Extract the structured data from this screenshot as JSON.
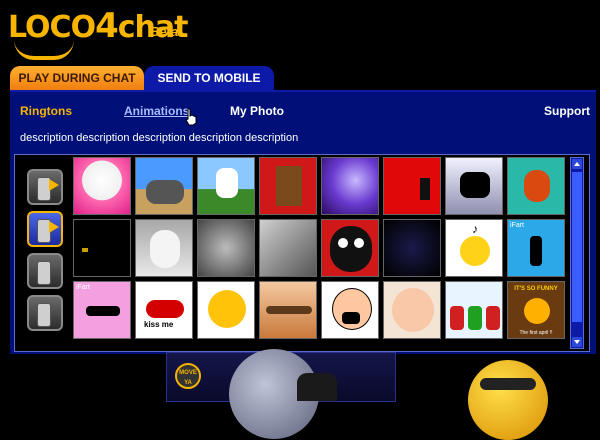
{
  "logo": {
    "text_a": "LOCO",
    "text_b": "4",
    "text_c": "chat",
    "beta": "Beta"
  },
  "tabs": [
    {
      "label": "PLAY DURING CHAT",
      "active": false
    },
    {
      "label": "SEND TO MOBILE",
      "active": true
    }
  ],
  "nav": {
    "ringtons": "Ringtons",
    "animations": "Animations",
    "my_photo": "My Photo",
    "support": "Support"
  },
  "description": "description description description description description",
  "colors": {
    "accent": "#f7b500",
    "panel": "#001078",
    "tab_active": "#0d1aa8"
  },
  "side_icons": [
    {
      "name": "ringtone-to-phone-icon",
      "active": false
    },
    {
      "name": "animation-to-phone-icon",
      "active": true
    },
    {
      "name": "phone-icon",
      "active": false
    },
    {
      "name": "phone-icon",
      "active": false
    }
  ],
  "thumbnails": {
    "row1": [
      "kitten",
      "elephant",
      "dog",
      "cuckoo-clock",
      "wolf-moon",
      "red-running-man",
      "horse-silhouette",
      "rooster"
    ],
    "row2": [
      "dark-creature",
      "sheep",
      "baby-face",
      "scared-face",
      "black-ghoul",
      "black-panther",
      "music-smiley",
      "dancer-silhouette"
    ],
    "row3": [
      "pink-dancer",
      "kiss-me-lips",
      "smiley-crying",
      "eagle",
      "screaming-cartoon",
      "laughing-baby",
      "christmas-kids",
      "its-so-funny"
    ]
  },
  "thumb_labels": {
    "dancer": "iFart",
    "pink": "iFart",
    "kiss": "kiss me",
    "funny_top": "IT'S SO FUNNY",
    "funny_bottom": "The first april !!"
  },
  "banner": {
    "badge": "MOVE YA"
  }
}
